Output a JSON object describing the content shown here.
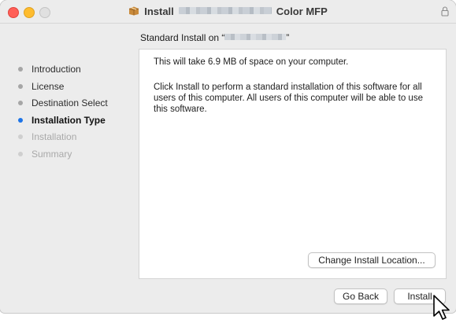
{
  "window": {
    "title_prefix": "Install",
    "title_suffix": "Color MFP"
  },
  "subtitle": {
    "prefix": "Standard Install on “",
    "suffix": "”"
  },
  "sidebar": {
    "items": [
      {
        "label": "Introduction",
        "state": "done"
      },
      {
        "label": "License",
        "state": "done"
      },
      {
        "label": "Destination Select",
        "state": "done"
      },
      {
        "label": "Installation Type",
        "state": "current"
      },
      {
        "label": "Installation",
        "state": "future"
      },
      {
        "label": "Summary",
        "state": "future"
      }
    ]
  },
  "content": {
    "space_text": "This will take 6.9 MB of space on your computer.",
    "description": "Click Install to perform a standard installation of this software for all users of this computer. All users of this computer will be able to use this software."
  },
  "buttons": {
    "change_location": "Change Install Location...",
    "go_back": "Go Back",
    "install": "Install"
  },
  "colors": {
    "accent": "#1d74e7",
    "close": "#ff5f57",
    "minimize": "#febc2e",
    "zoom_inactive": "#e0e0e0"
  },
  "icons": {
    "title": "package-icon",
    "lock": "lock-icon",
    "cursor": "pointer-cursor-icon"
  }
}
